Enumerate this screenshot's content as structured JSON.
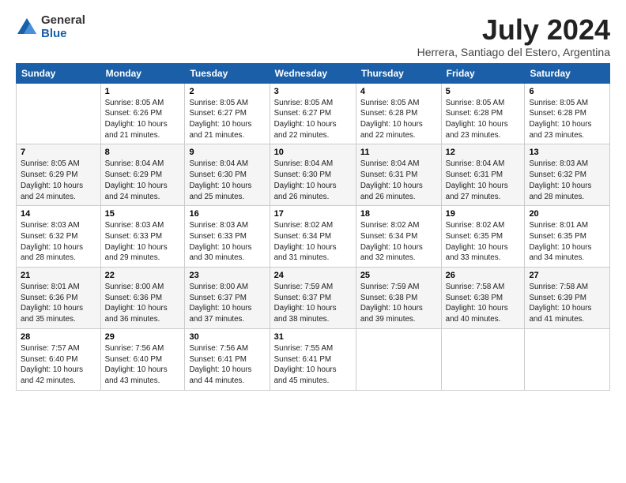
{
  "logo": {
    "general": "General",
    "blue": "Blue"
  },
  "title": "July 2024",
  "subtitle": "Herrera, Santiago del Estero, Argentina",
  "headers": [
    "Sunday",
    "Monday",
    "Tuesday",
    "Wednesday",
    "Thursday",
    "Friday",
    "Saturday"
  ],
  "weeks": [
    [
      {
        "day": "",
        "info": ""
      },
      {
        "day": "1",
        "info": "Sunrise: 8:05 AM\nSunset: 6:26 PM\nDaylight: 10 hours\nand 21 minutes."
      },
      {
        "day": "2",
        "info": "Sunrise: 8:05 AM\nSunset: 6:27 PM\nDaylight: 10 hours\nand 21 minutes."
      },
      {
        "day": "3",
        "info": "Sunrise: 8:05 AM\nSunset: 6:27 PM\nDaylight: 10 hours\nand 22 minutes."
      },
      {
        "day": "4",
        "info": "Sunrise: 8:05 AM\nSunset: 6:28 PM\nDaylight: 10 hours\nand 22 minutes."
      },
      {
        "day": "5",
        "info": "Sunrise: 8:05 AM\nSunset: 6:28 PM\nDaylight: 10 hours\nand 23 minutes."
      },
      {
        "day": "6",
        "info": "Sunrise: 8:05 AM\nSunset: 6:28 PM\nDaylight: 10 hours\nand 23 minutes."
      }
    ],
    [
      {
        "day": "7",
        "info": "Sunrise: 8:05 AM\nSunset: 6:29 PM\nDaylight: 10 hours\nand 24 minutes."
      },
      {
        "day": "8",
        "info": "Sunrise: 8:04 AM\nSunset: 6:29 PM\nDaylight: 10 hours\nand 24 minutes."
      },
      {
        "day": "9",
        "info": "Sunrise: 8:04 AM\nSunset: 6:30 PM\nDaylight: 10 hours\nand 25 minutes."
      },
      {
        "day": "10",
        "info": "Sunrise: 8:04 AM\nSunset: 6:30 PM\nDaylight: 10 hours\nand 26 minutes."
      },
      {
        "day": "11",
        "info": "Sunrise: 8:04 AM\nSunset: 6:31 PM\nDaylight: 10 hours\nand 26 minutes."
      },
      {
        "day": "12",
        "info": "Sunrise: 8:04 AM\nSunset: 6:31 PM\nDaylight: 10 hours\nand 27 minutes."
      },
      {
        "day": "13",
        "info": "Sunrise: 8:03 AM\nSunset: 6:32 PM\nDaylight: 10 hours\nand 28 minutes."
      }
    ],
    [
      {
        "day": "14",
        "info": "Sunrise: 8:03 AM\nSunset: 6:32 PM\nDaylight: 10 hours\nand 28 minutes."
      },
      {
        "day": "15",
        "info": "Sunrise: 8:03 AM\nSunset: 6:33 PM\nDaylight: 10 hours\nand 29 minutes."
      },
      {
        "day": "16",
        "info": "Sunrise: 8:03 AM\nSunset: 6:33 PM\nDaylight: 10 hours\nand 30 minutes."
      },
      {
        "day": "17",
        "info": "Sunrise: 8:02 AM\nSunset: 6:34 PM\nDaylight: 10 hours\nand 31 minutes."
      },
      {
        "day": "18",
        "info": "Sunrise: 8:02 AM\nSunset: 6:34 PM\nDaylight: 10 hours\nand 32 minutes."
      },
      {
        "day": "19",
        "info": "Sunrise: 8:02 AM\nSunset: 6:35 PM\nDaylight: 10 hours\nand 33 minutes."
      },
      {
        "day": "20",
        "info": "Sunrise: 8:01 AM\nSunset: 6:35 PM\nDaylight: 10 hours\nand 34 minutes."
      }
    ],
    [
      {
        "day": "21",
        "info": "Sunrise: 8:01 AM\nSunset: 6:36 PM\nDaylight: 10 hours\nand 35 minutes."
      },
      {
        "day": "22",
        "info": "Sunrise: 8:00 AM\nSunset: 6:36 PM\nDaylight: 10 hours\nand 36 minutes."
      },
      {
        "day": "23",
        "info": "Sunrise: 8:00 AM\nSunset: 6:37 PM\nDaylight: 10 hours\nand 37 minutes."
      },
      {
        "day": "24",
        "info": "Sunrise: 7:59 AM\nSunset: 6:37 PM\nDaylight: 10 hours\nand 38 minutes."
      },
      {
        "day": "25",
        "info": "Sunrise: 7:59 AM\nSunset: 6:38 PM\nDaylight: 10 hours\nand 39 minutes."
      },
      {
        "day": "26",
        "info": "Sunrise: 7:58 AM\nSunset: 6:38 PM\nDaylight: 10 hours\nand 40 minutes."
      },
      {
        "day": "27",
        "info": "Sunrise: 7:58 AM\nSunset: 6:39 PM\nDaylight: 10 hours\nand 41 minutes."
      }
    ],
    [
      {
        "day": "28",
        "info": "Sunrise: 7:57 AM\nSunset: 6:40 PM\nDaylight: 10 hours\nand 42 minutes."
      },
      {
        "day": "29",
        "info": "Sunrise: 7:56 AM\nSunset: 6:40 PM\nDaylight: 10 hours\nand 43 minutes."
      },
      {
        "day": "30",
        "info": "Sunrise: 7:56 AM\nSunset: 6:41 PM\nDaylight: 10 hours\nand 44 minutes."
      },
      {
        "day": "31",
        "info": "Sunrise: 7:55 AM\nSunset: 6:41 PM\nDaylight: 10 hours\nand 45 minutes."
      },
      {
        "day": "",
        "info": ""
      },
      {
        "day": "",
        "info": ""
      },
      {
        "day": "",
        "info": ""
      }
    ]
  ]
}
